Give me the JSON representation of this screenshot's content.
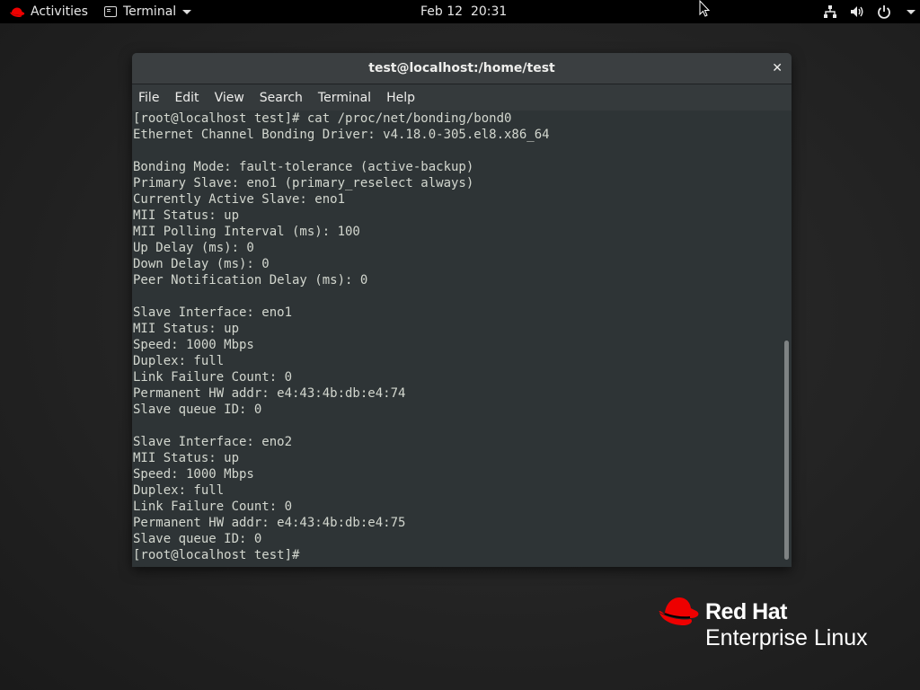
{
  "topbar": {
    "activities_label": "Activities",
    "app_menu_label": "Terminal",
    "clock": "Feb 12  20:31"
  },
  "window": {
    "title": "test@localhost:/home/test",
    "close_glyph": "✕"
  },
  "menubar": {
    "items": [
      "File",
      "Edit",
      "View",
      "Search",
      "Terminal",
      "Help"
    ]
  },
  "terminal": {
    "lines": [
      "[root@localhost test]# cat /proc/net/bonding/bond0",
      "Ethernet Channel Bonding Driver: v4.18.0-305.el8.x86_64",
      "",
      "Bonding Mode: fault-tolerance (active-backup)",
      "Primary Slave: eno1 (primary_reselect always)",
      "Currently Active Slave: eno1",
      "MII Status: up",
      "MII Polling Interval (ms): 100",
      "Up Delay (ms): 0",
      "Down Delay (ms): 0",
      "Peer Notification Delay (ms): 0",
      "",
      "Slave Interface: eno1",
      "MII Status: up",
      "Speed: 1000 Mbps",
      "Duplex: full",
      "Link Failure Count: 0",
      "Permanent HW addr: e4:43:4b:db:e4:74",
      "Slave queue ID: 0",
      "",
      "Slave Interface: eno2",
      "MII Status: up",
      "Speed: 1000 Mbps",
      "Duplex: full",
      "Link Failure Count: 0",
      "Permanent HW addr: e4:43:4b:db:e4:75",
      "Slave queue ID: 0",
      "[root@localhost test]# "
    ]
  },
  "logo": {
    "brand": "Red Hat",
    "product": "Enterprise Linux"
  },
  "colors": {
    "accent": "#ee0000",
    "terminal_bg": "#2e3436",
    "terminal_fg": "#d3d7cf"
  },
  "icons": [
    "redhat-icon",
    "terminal-icon",
    "network-icon",
    "volume-icon",
    "power-icon",
    "chevron-down-icon",
    "close-icon"
  ]
}
